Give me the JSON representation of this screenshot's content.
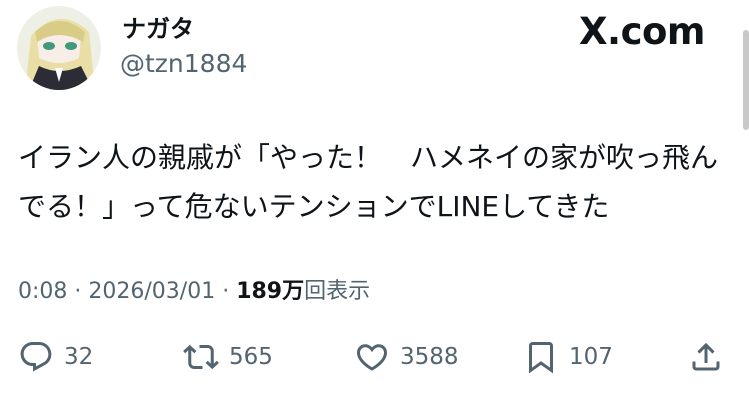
{
  "user": {
    "display_name": "ナガタ",
    "handle": "@tzn1884"
  },
  "brand": {
    "site": "X.com"
  },
  "tweet": {
    "text": "イラン人の親戚が「やった！　ハメネイの家が吹っ飛んでる！」って危ないテンションでLINEしてきた"
  },
  "meta": {
    "time": "0:08",
    "separator1": " · ",
    "date": "2026/03/01",
    "separator2": " · ",
    "views_count": "189万",
    "views_label": "回表示"
  },
  "actions": {
    "reply": {
      "icon": "reply-icon",
      "count": "32"
    },
    "retweet": {
      "icon": "retweet-icon",
      "count": "565"
    },
    "like": {
      "icon": "heart-icon",
      "count": "3588"
    },
    "bookmark": {
      "icon": "bookmark-icon",
      "count": "107"
    },
    "share": {
      "icon": "share-icon"
    }
  },
  "colors": {
    "text": "#0f1419",
    "muted": "#536471"
  }
}
